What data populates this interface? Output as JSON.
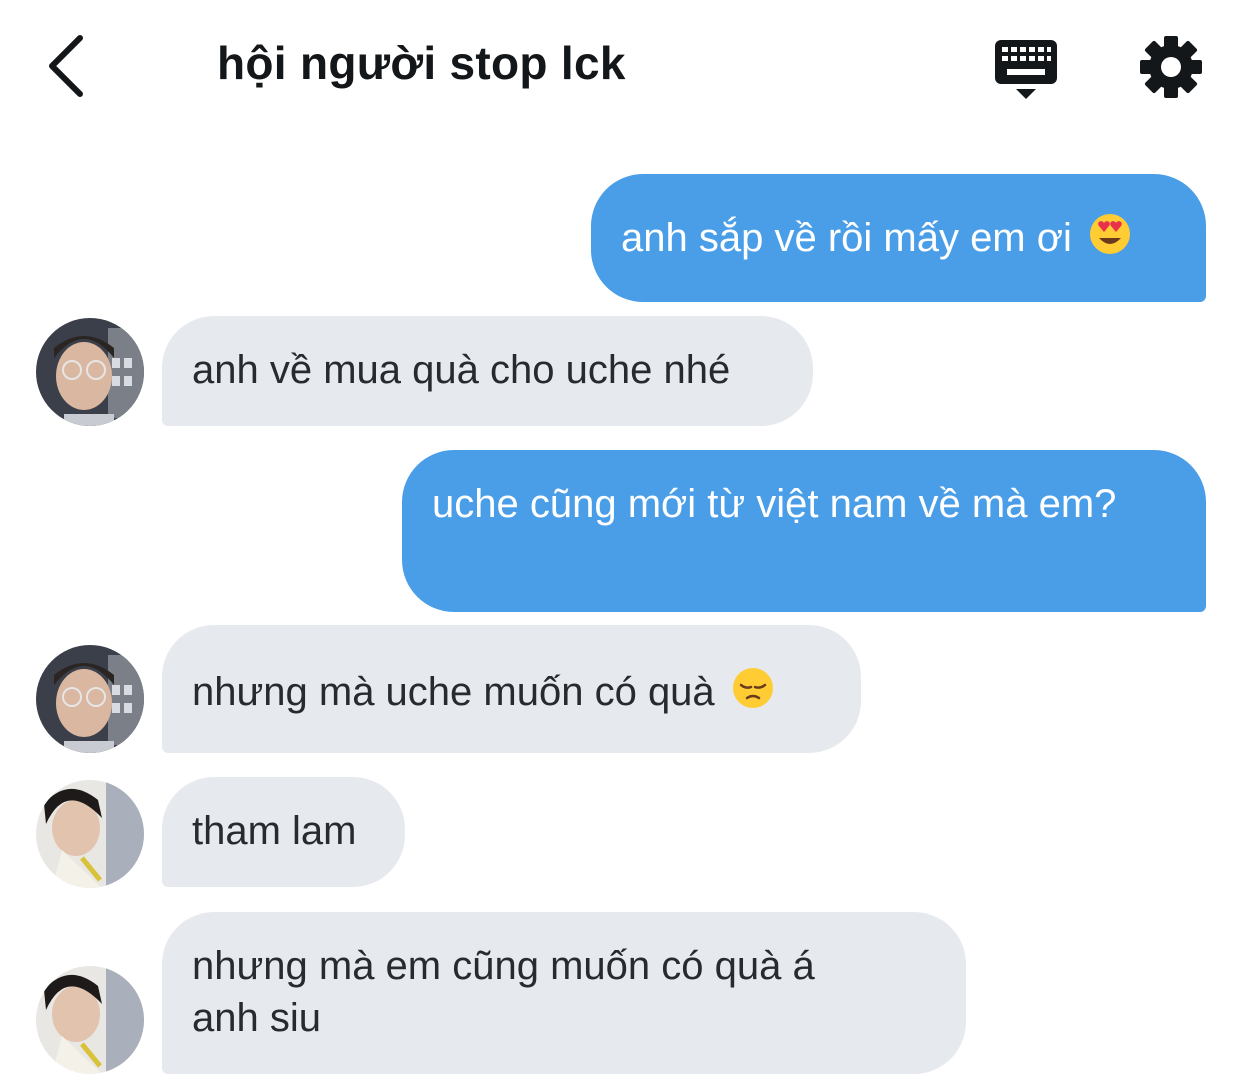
{
  "header": {
    "title": "hội người stop lck"
  },
  "messages": [
    {
      "side": "out",
      "text": "anh sắp về rồi mấy em ơi",
      "emoji": "heart-eyes"
    },
    {
      "side": "in",
      "avatar": "user-a",
      "text": "anh về mua quà cho uche nhé"
    },
    {
      "side": "out",
      "text": "uche cũng mới từ việt nam về mà em?"
    },
    {
      "side": "in",
      "avatar": "user-a",
      "text": "nhưng mà uche muốn có quà",
      "emoji": "pensive"
    },
    {
      "side": "in",
      "avatar": "user-b",
      "text": "tham lam"
    },
    {
      "side": "in",
      "avatar": "user-b",
      "text": "nhưng mà em cũng muốn có quà á anh siu"
    }
  ],
  "colors": {
    "outgoing_bubble": "#4a9ee8",
    "incoming_bubble": "#e6e9ee",
    "title": "#14171a"
  },
  "icons": [
    "back-arrow-icon",
    "keyboard-icon",
    "gear-icon",
    "heart-eyes-emoji-icon",
    "pensive-emoji-icon"
  ]
}
